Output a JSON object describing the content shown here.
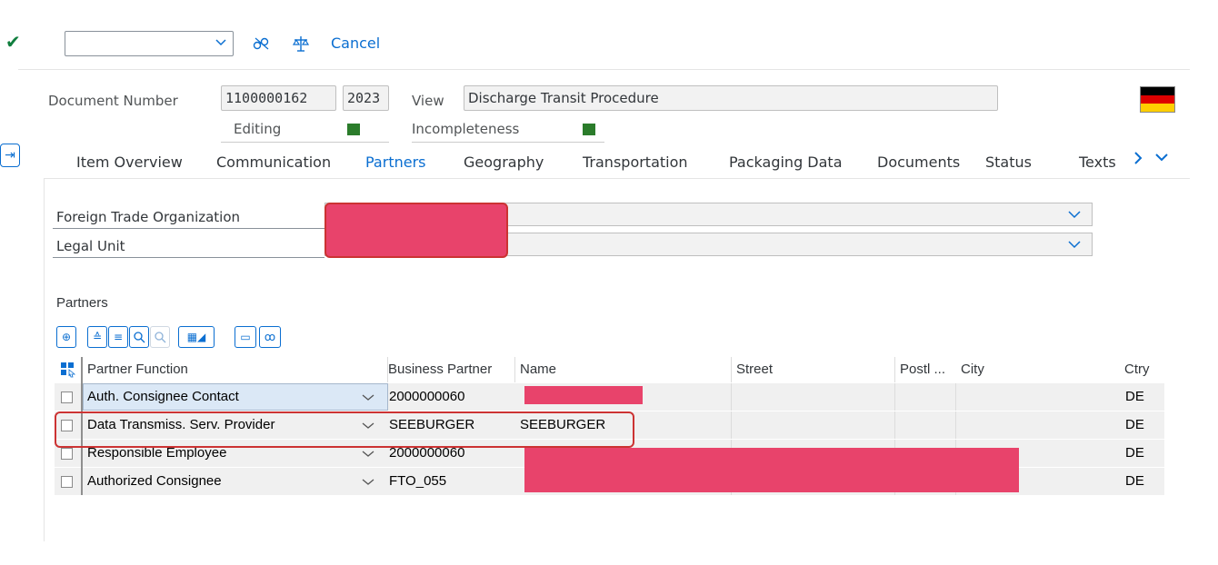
{
  "toolbar": {
    "select_value": "",
    "cancel_label": "Cancel",
    "icons": [
      "checkmark-icon",
      "chevron-down-icon",
      "glasses-icon",
      "balance-icon"
    ]
  },
  "header": {
    "document_number_label": "Document Number",
    "document_number": "1100000162",
    "year": "2023",
    "view_label": "View",
    "view_value": "Discharge Transit Procedure",
    "editing_label": "Editing",
    "incompleteness_label": "Incompleteness",
    "status_color": "#2b7c2b",
    "flag": "german-flag"
  },
  "tabs": [
    {
      "label": "Item Overview"
    },
    {
      "label": "Communication"
    },
    {
      "label": "Partners"
    },
    {
      "label": "Geography"
    },
    {
      "label": "Transportation"
    },
    {
      "label": "Packaging Data"
    },
    {
      "label": "Documents"
    },
    {
      "label": "Status"
    },
    {
      "label": "Texts"
    }
  ],
  "active_tab": "Partners",
  "form": {
    "fto_label": "Foreign Trade Organization",
    "legal_unit_label": "Legal Unit"
  },
  "partners": {
    "title": "Partners",
    "columns": [
      "Partner Function",
      "Business Partner",
      "Name",
      "Street",
      "Postl ...",
      "City",
      "Ctry"
    ],
    "rows": [
      {
        "function": "Auth. Consignee Contact",
        "partner": "2000000060",
        "name": "",
        "street": "",
        "postal": "",
        "city": "",
        "ctry": "DE"
      },
      {
        "function": "Data Transmiss. Serv. Provider",
        "partner": "SEEBURGER",
        "name": "SEEBURGER",
        "street": "",
        "postal": "",
        "city": "",
        "ctry": "DE"
      },
      {
        "function": "Responsible Employee",
        "partner": "2000000060",
        "name": "",
        "street": "",
        "postal": "",
        "city": "",
        "ctry": "DE"
      },
      {
        "function": "Authorized Consignee",
        "partner": "FTO_055",
        "name": "",
        "street": "",
        "postal": "",
        "city": "",
        "ctry": "DE"
      }
    ]
  },
  "colors": {
    "accent": "#0a6ed1",
    "redaction": "#e8436b",
    "highlight_border": "#cc3333"
  }
}
